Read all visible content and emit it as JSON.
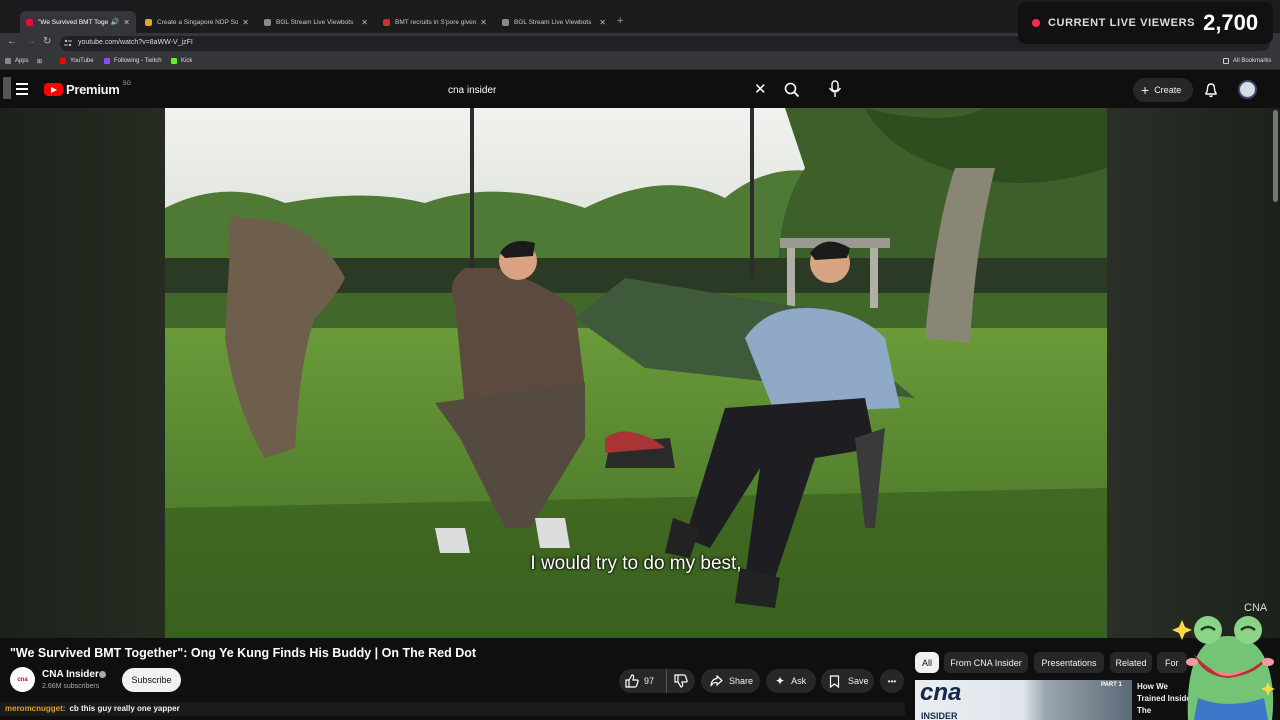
{
  "browser": {
    "tabs": [
      {
        "title": "\"We Survived BMT Together\"",
        "favicon_color": "#ff0033",
        "active": true
      },
      {
        "title": "Create a Singapore NDP Song",
        "favicon_color": "#d9a640",
        "active": false
      },
      {
        "title": "BGL Stream Live Viewbots",
        "favicon_color": "#8a8a8a",
        "active": false
      },
      {
        "title": "BMT recruits in S'pore given m",
        "favicon_color": "#d32f2f",
        "active": false
      },
      {
        "title": "BGL Stream Live Viewbots",
        "favicon_color": "#8a8a8a",
        "active": false
      }
    ],
    "new_tab": "+",
    "url": "youtube.com/watch?v=8aWW-V_jzFI",
    "bookmarks": [
      {
        "label": "Apps",
        "color": "#888888"
      },
      {
        "label": "YouTube",
        "color": "#ff0000"
      },
      {
        "label": "Following - Twitch",
        "color": "#9146ff"
      },
      {
        "label": "Kick",
        "color": "#53fc18"
      }
    ],
    "all_bookmarks": "All Bookmarks"
  },
  "overlay": {
    "viewers_label": "CURRENT LIVE VIEWERS",
    "viewers_count": "2,700",
    "chat_user": "meromcnugget:",
    "chat_message": "cb this guy really one yapper"
  },
  "youtube": {
    "logo_text": "Premium",
    "region": "SG",
    "search_query": "cna insider",
    "create_label": "Create",
    "subtitle": "I would try to do my best,",
    "watermark": "CNA",
    "video_title": "\"We Survived BMT Together\": Ong Ye Kung Finds His Buddy | On The Red Dot",
    "channel_name": "CNA Insider",
    "channel_avatar_text": "cna",
    "subscribers": "2.66M subscribers",
    "subscribe_label": "Subscribe",
    "likes": "97",
    "share_label": "Share",
    "ask_label": "Ask",
    "save_label": "Save",
    "more_label": "•••",
    "chips": [
      "All",
      "From CNA Insider",
      "Presentations",
      "Related",
      "For"
    ],
    "related": {
      "thumb_text": "cna",
      "thumb_sub": "INSIDER",
      "part": "PART 1",
      "title": "How We Trained Inside The"
    }
  }
}
